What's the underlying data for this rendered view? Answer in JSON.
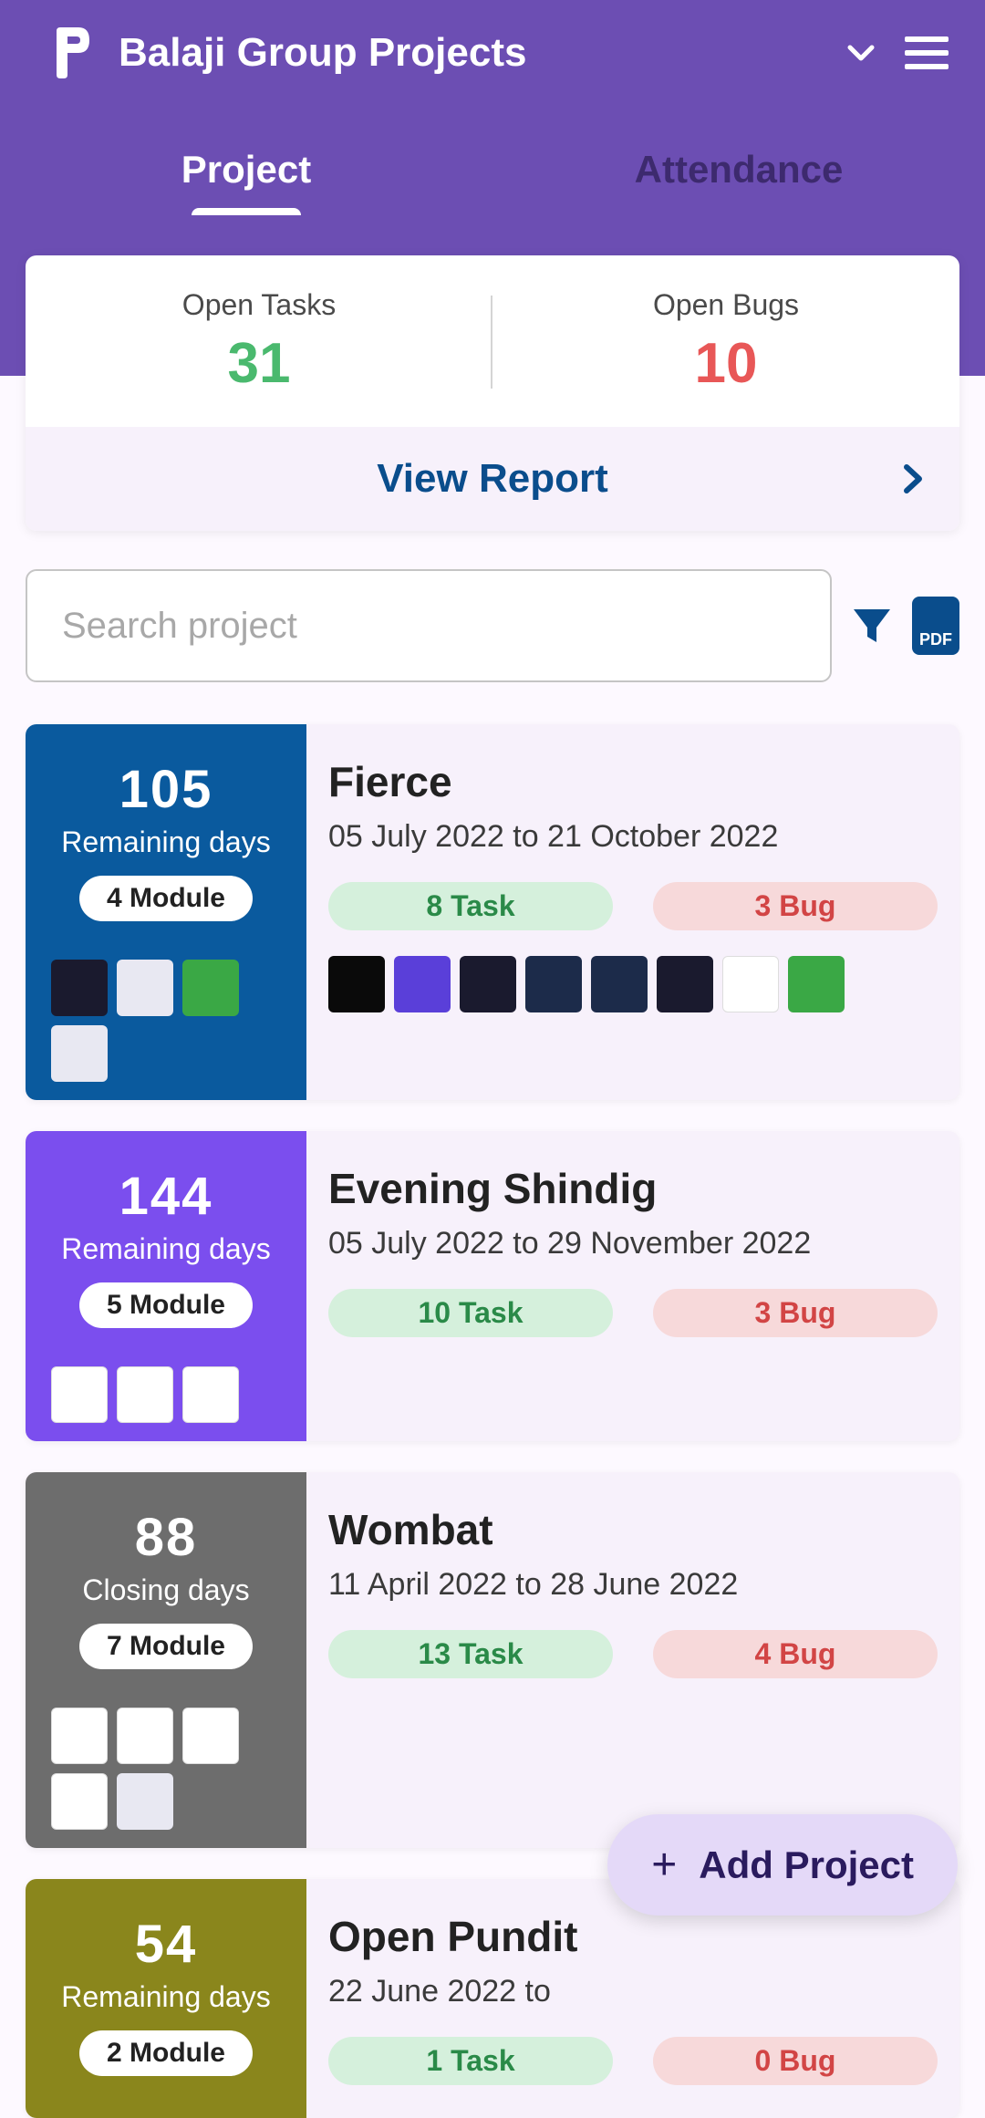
{
  "header": {
    "title": "Balaji Group Projects"
  },
  "tabs": {
    "project": "Project",
    "attendance": "Attendance"
  },
  "stats": {
    "open_tasks_label": "Open Tasks",
    "open_tasks_value": "31",
    "open_bugs_label": "Open Bugs",
    "open_bugs_value": "10",
    "view_report": "View Report"
  },
  "search": {
    "placeholder": "Search project",
    "pdf": "PDF"
  },
  "projects": [
    {
      "days": "105",
      "days_label": "Remaining days",
      "modules": "4 Module",
      "name": "Fierce",
      "dates": "05 July 2022 to 21 October 2022",
      "tasks": "8 Task",
      "bugs": "3 Bug"
    },
    {
      "days": "144",
      "days_label": "Remaining days",
      "modules": "5 Module",
      "name": "Evening Shindig",
      "dates": "05 July 2022 to 29 November 2022",
      "tasks": "10 Task",
      "bugs": "3 Bug"
    },
    {
      "days": "88",
      "days_label": "Closing days",
      "modules": "7 Module",
      "name": "Wombat",
      "dates": "11 April 2022 to 28 June 2022",
      "tasks": "13 Task",
      "bugs": "4 Bug"
    },
    {
      "days": "54",
      "days_label": "Remaining days",
      "modules": "2 Module",
      "name": "Open Pundit",
      "dates": "22 June 2022 to",
      "tasks": "1 Task",
      "bugs": "0 Bug"
    }
  ],
  "fab": {
    "label": "Add Project"
  }
}
